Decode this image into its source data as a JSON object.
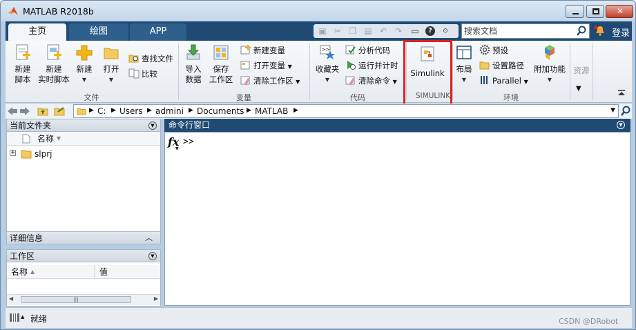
{
  "window": {
    "title": "MATLAB R2018b"
  },
  "tabs": [
    {
      "label": "主页"
    },
    {
      "label": "绘图"
    },
    {
      "label": "APP"
    }
  ],
  "search": {
    "placeholder": "搜索文档"
  },
  "account": {
    "login_label": "登录"
  },
  "ribbon": {
    "file_group": {
      "label": "文件",
      "new_script": [
        "新建",
        "脚本"
      ],
      "new_live_script": [
        "新建",
        "实时脚本"
      ],
      "new": "新建",
      "open": "打开",
      "find_files": "查找文件",
      "compare": "比较"
    },
    "variable_group": {
      "label": "变量",
      "import_data": [
        "导入",
        "数据"
      ],
      "save_workspace": [
        "保存",
        "工作区"
      ],
      "new_variable": "新建变量",
      "open_variable": "打开变量",
      "clear_workspace": "清除工作区"
    },
    "code_group": {
      "label": "代码",
      "favorites": "收藏夹",
      "analyze_code": "分析代码",
      "run_and_time": "运行并计时",
      "clear_commands": "清除命令"
    },
    "simulink_group": {
      "label": "SIMULINK",
      "simulink": "Simulink"
    },
    "environment_group": {
      "label": "环境",
      "layout": "布局",
      "preferences": "预设",
      "set_path": "设置路径",
      "parallel": "Parallel",
      "add_ons": "附加功能"
    },
    "resources_group": {
      "label": "资源"
    }
  },
  "address": {
    "path": [
      "C:",
      "Users",
      "admini",
      "Documents",
      "MATLAB"
    ]
  },
  "current_folder": {
    "title": "当前文件夹",
    "column_name": "名称",
    "items": [
      {
        "name": "slprj"
      }
    ]
  },
  "details": {
    "title": "详细信息"
  },
  "workspace": {
    "title": "工作区",
    "column_name": "名称",
    "column_value": "值"
  },
  "command_window": {
    "title": "命令行窗口",
    "fx": "fx",
    "prompt": ">>"
  },
  "status": {
    "text": "就绪"
  },
  "watermark": "CSDN @DRobot",
  "colors": {
    "tab_strip": "#1f4a73",
    "highlight": "#e0211b",
    "window_frame": "#b7cde3"
  }
}
